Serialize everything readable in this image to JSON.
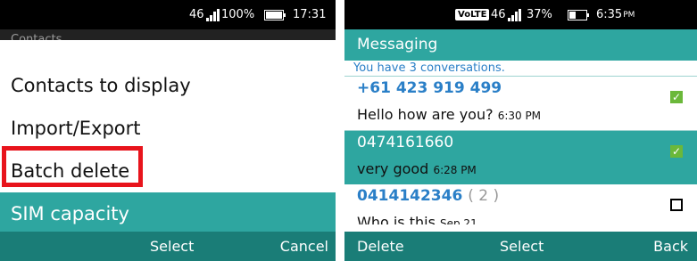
{
  "left": {
    "status": {
      "network": "46",
      "battery": "100%",
      "time": "17:31"
    },
    "header_partial": "Contacts",
    "menu": [
      {
        "label": "Contacts to display"
      },
      {
        "label": "Import/Export"
      },
      {
        "label": "Batch delete"
      },
      {
        "label": "SIM capacity"
      }
    ],
    "softkeys": {
      "center": "Select",
      "right": "Cancel"
    }
  },
  "right": {
    "status": {
      "volte": "VoLTE",
      "network": "46",
      "battery": "37%",
      "time": "6:35",
      "ampm": "PM"
    },
    "title": "Messaging",
    "conversation_count": "You have 3 conversations.",
    "conversations": [
      {
        "number": "+61 423 919 499",
        "message": "Hello how are you?",
        "time": "6:30 PM",
        "checked": true
      },
      {
        "number": "0474161660",
        "message": "very good",
        "time": "6:28 PM",
        "checked": true
      },
      {
        "number": "0414142346",
        "count": "( 2 )",
        "message": "Who is this",
        "time": "Sep 21",
        "checked": false
      }
    ],
    "softkeys": {
      "left": "Delete",
      "center": "Select",
      "right": "Back"
    }
  },
  "colors": {
    "teal": "#2ea6a0",
    "teal_dark": "#1a7d77",
    "highlight_red": "#e8141c",
    "link_blue": "#2a7fc7",
    "check_green": "#6bb83a"
  }
}
